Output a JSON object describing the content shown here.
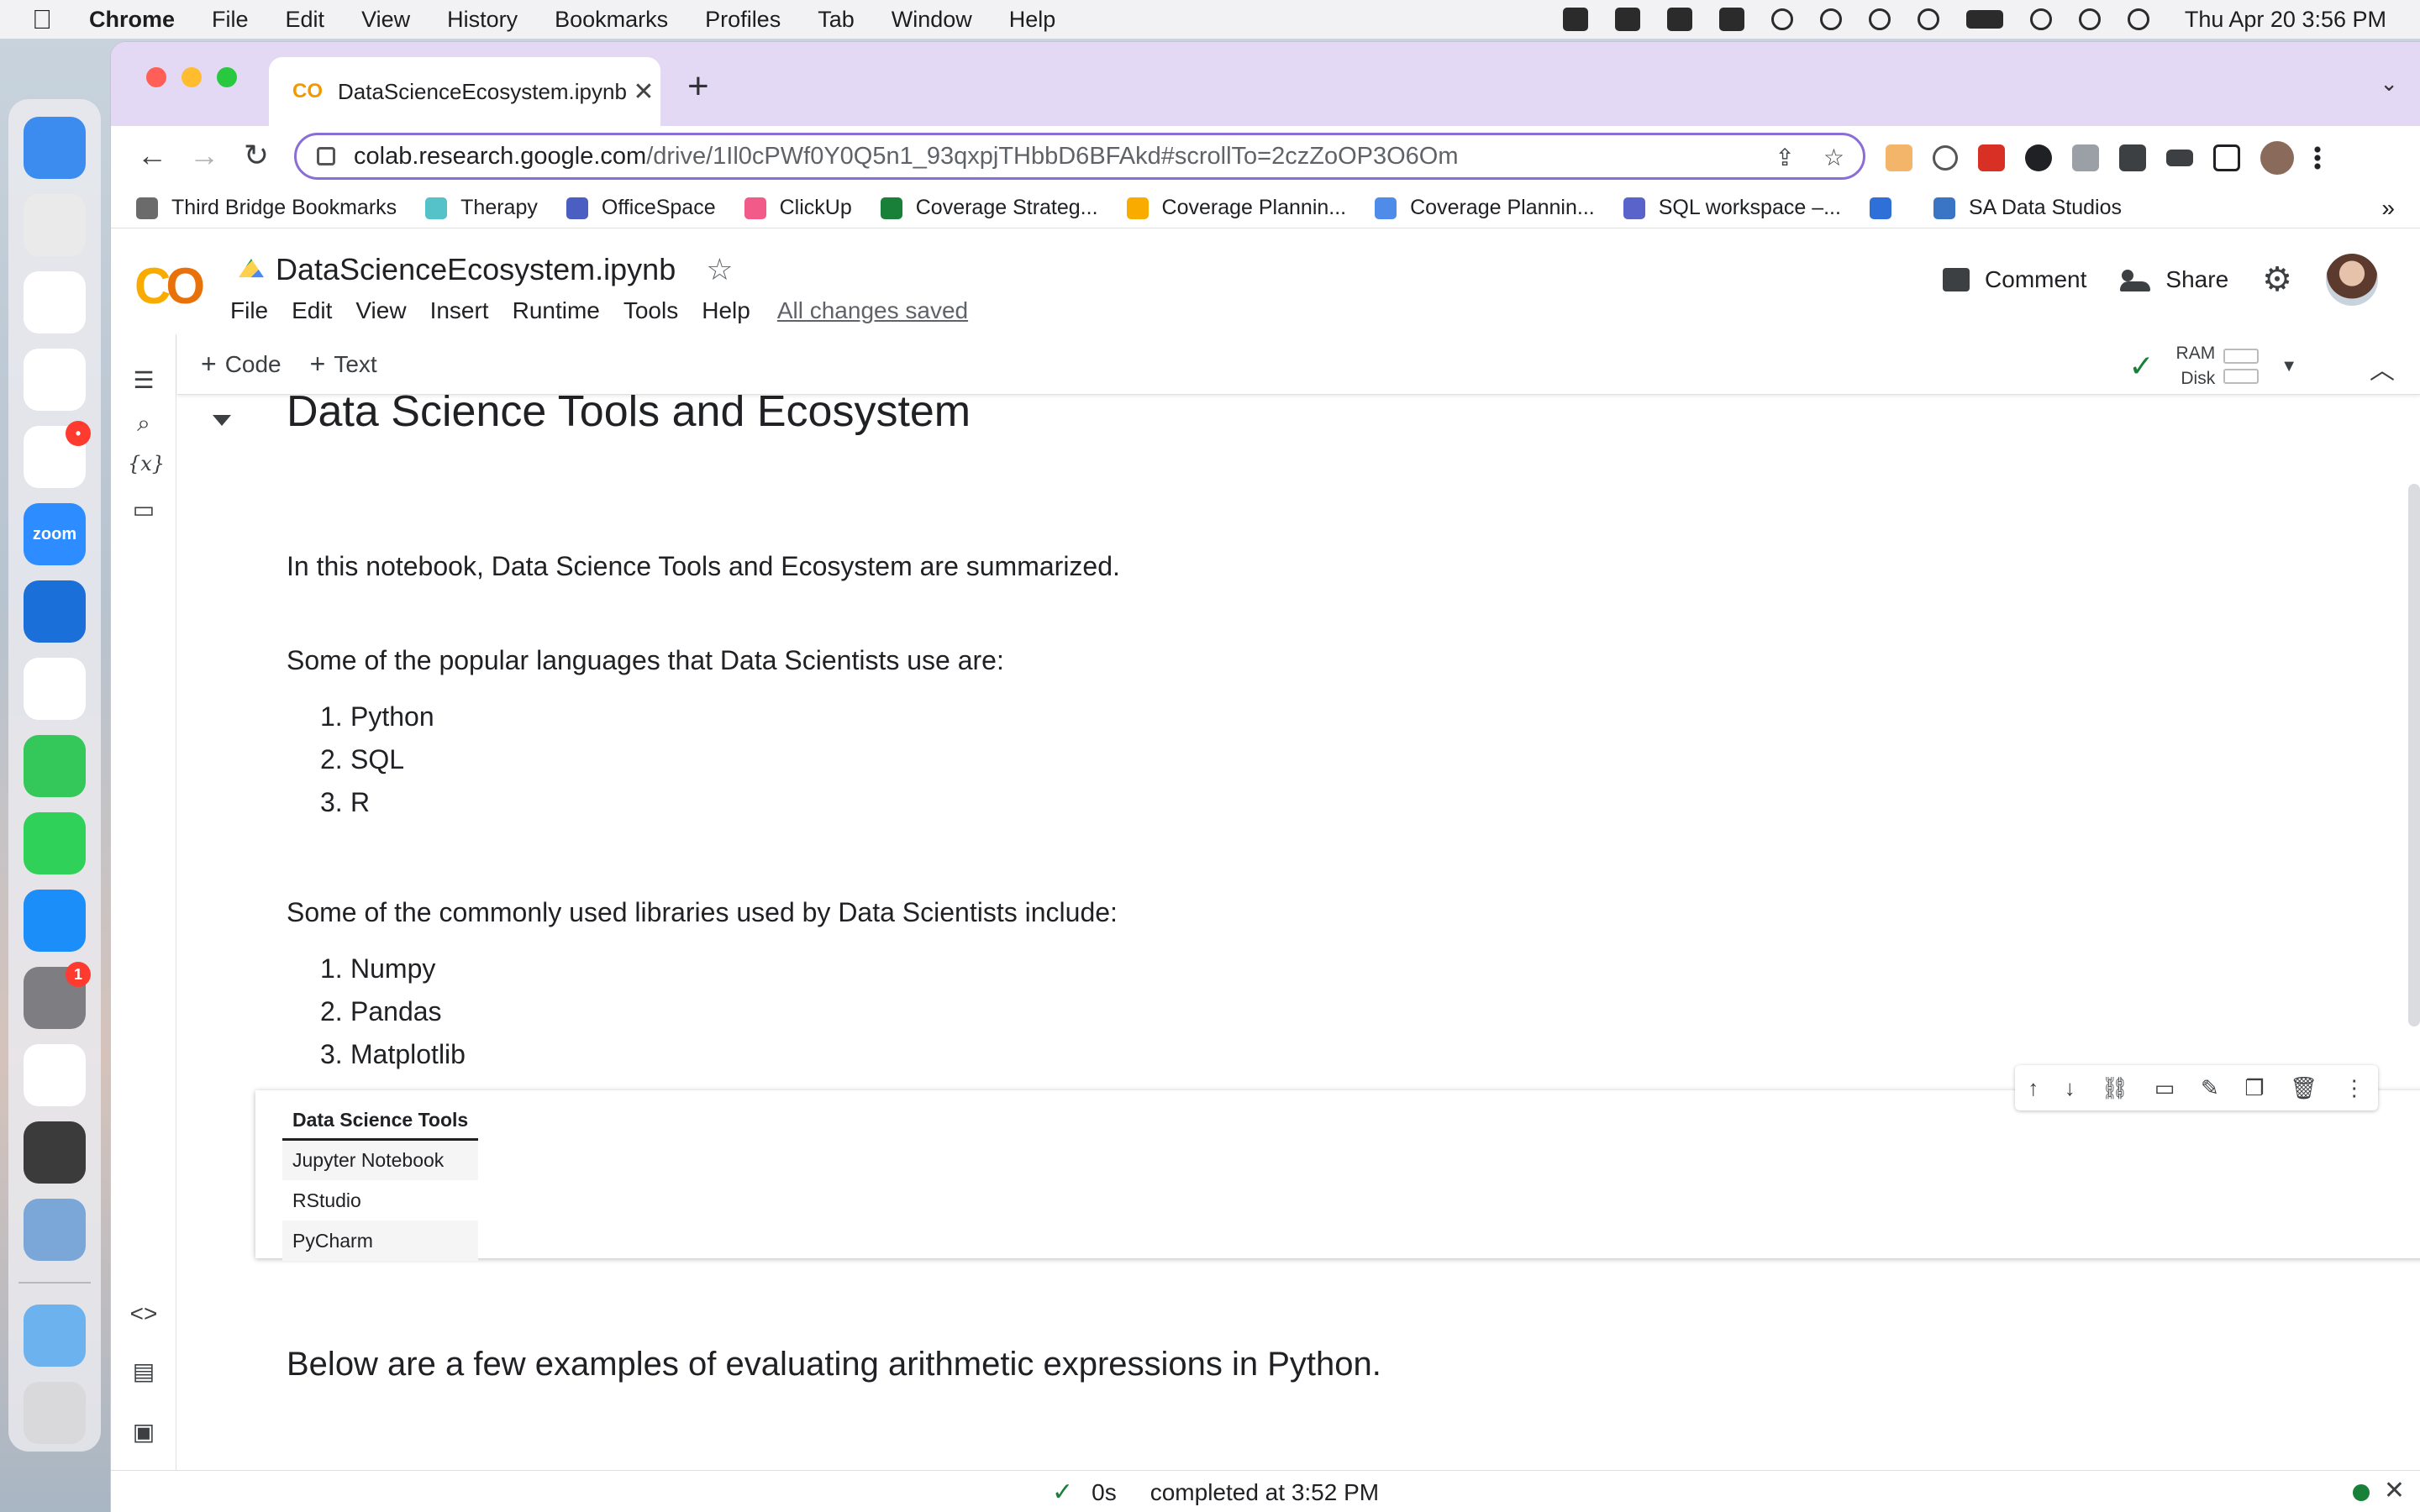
{
  "menubar": {
    "app": "Chrome",
    "items": [
      "File",
      "Edit",
      "View",
      "History",
      "Bookmarks",
      "Profiles",
      "Tab",
      "Window",
      "Help"
    ],
    "clock": "Thu Apr 20  3:56 PM"
  },
  "dock": {
    "apps": [
      {
        "name": "Finder",
        "color": "#3c8cf0",
        "label": "",
        "badge": ""
      },
      {
        "name": "Launchpad",
        "color": "#eaeaea",
        "label": "",
        "badge": ""
      },
      {
        "name": "Chrome",
        "color": "#ffffff",
        "label": "",
        "badge": ""
      },
      {
        "name": "Google Drive",
        "color": "#ffffff",
        "label": "",
        "badge": ""
      },
      {
        "name": "Slack",
        "color": "#ffffff",
        "label": "",
        "badge": "•"
      },
      {
        "name": "Zoom",
        "color": "#2d8cff",
        "label": "zoom",
        "badge": ""
      },
      {
        "name": "TeamViewer",
        "color": "#1a6fd8",
        "label": "",
        "badge": ""
      },
      {
        "name": "Honey",
        "color": "#ffffff",
        "label": "",
        "badge": ""
      },
      {
        "name": "Messages",
        "color": "#34c759",
        "label": "",
        "badge": ""
      },
      {
        "name": "FaceTime",
        "color": "#30d158",
        "label": "",
        "badge": ""
      },
      {
        "name": "App Store",
        "color": "#1c8ef9",
        "label": "",
        "badge": ""
      },
      {
        "name": "System Settings",
        "color": "#7d7d82",
        "label": "",
        "badge": "1"
      },
      {
        "name": "Circle",
        "color": "#ffffff",
        "label": "",
        "badge": ""
      },
      {
        "name": "Sublime Text",
        "color": "#3b3b3b",
        "label": "",
        "badge": ""
      },
      {
        "name": "Preview",
        "color": "#7aa7d8",
        "label": "",
        "badge": ""
      }
    ],
    "trailing": [
      {
        "name": "Applications folder",
        "color": "#6cb2ee"
      },
      {
        "name": "Trash",
        "color": "#d9d9dc"
      }
    ]
  },
  "browser": {
    "tab_title": "DataScienceEcosystem.ipynb - ",
    "tab_favicon": "CO",
    "url_host": "colab.research.google.com",
    "url_path": "/drive/1Il0cPWf0Y0Q5n1_93qxpjTHbbD6BFAkd#scrollTo=2czZoOP3O6Om",
    "bookmarks": [
      {
        "label": "Third Bridge Bookmarks",
        "color": "#6b6b6b"
      },
      {
        "label": "Therapy",
        "color": "#55c1c8"
      },
      {
        "label": "OfficeSpace",
        "color": "#4a5fc1"
      },
      {
        "label": "ClickUp",
        "color": "#f25a8a"
      },
      {
        "label": "Coverage Strateg...",
        "color": "#188038"
      },
      {
        "label": "Coverage Plannin...",
        "color": "#f9ab00"
      },
      {
        "label": "Coverage Plannin...",
        "color": "#4f8be8"
      },
      {
        "label": "SQL workspace –...",
        "color": "#5a63c9"
      },
      {
        "label": "",
        "color": "#2f6fd8"
      },
      {
        "label": "SA Data Studios",
        "color": "#3a74c4"
      }
    ],
    "bookmarks_more": "»"
  },
  "colab": {
    "logo": "CO",
    "notebook_title": "DataScienceEcosystem.ipynb",
    "menu": [
      "File",
      "Edit",
      "View",
      "Insert",
      "Runtime",
      "Tools",
      "Help"
    ],
    "saved_status": "All changes saved",
    "comment_label": "Comment",
    "share_label": "Share",
    "toolbar": {
      "code_label": "Code",
      "text_label": "Text",
      "ram_label": "RAM",
      "disk_label": "Disk"
    },
    "cells": {
      "heading": "Data Science Tools and Ecosystem",
      "intro": "In this notebook, Data Science Tools and Ecosystem are summarized.",
      "languages_intro": "Some of the popular languages that Data Scientists use are:",
      "languages": [
        {
          "num": "1.",
          "text": "Python"
        },
        {
          "num": "2.",
          "text": "SQL"
        },
        {
          "num": "3.",
          "text": "R"
        }
      ],
      "libraries_intro": "Some of the commonly used libraries used by Data Scientists include:",
      "libraries": [
        {
          "num": "1.",
          "text": "Numpy"
        },
        {
          "num": "2.",
          "text": "Pandas"
        },
        {
          "num": "3.",
          "text": "Matplotlib"
        }
      ],
      "table_header": "Data Science Tools",
      "table_rows": [
        "Jupyter Notebook",
        "RStudio",
        "PyCharm"
      ],
      "arithmetic_intro": "Below are a few examples of evaluating arithmetic expressions in Python."
    },
    "status": {
      "duration": "0s",
      "completed": "completed at 3:52 PM"
    }
  }
}
